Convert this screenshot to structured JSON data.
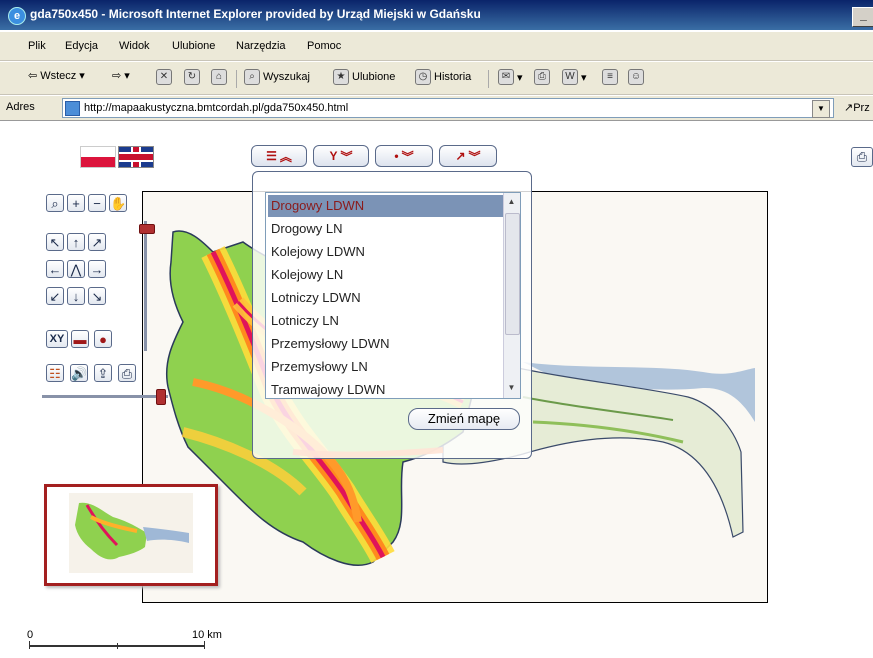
{
  "window": {
    "title": "gda750x450 - Microsoft Internet Explorer provided by Urząd Miejski w Gdańsku",
    "minimize_label": "_"
  },
  "menu": [
    "Plik",
    "Edycja",
    "Widok",
    "Ulubione",
    "Narzędzia",
    "Pomoc"
  ],
  "toolbar": {
    "back": "Wstecz",
    "search": "Wyszukaj",
    "favorites": "Ulubione",
    "history": "Historia"
  },
  "address": {
    "label": "Adres",
    "url": "http://mapaakustyczna.bmtcordah.pl/gda750x450.html",
    "go": "Prz"
  },
  "map_layers": {
    "items": [
      "Drogowy LDWN",
      "Drogowy LN",
      "Kolejowy LDWN",
      "Kolejowy LN",
      "Lotniczy LDWN",
      "Lotniczy LN",
      "Przemysłowy LDWN",
      "Przemysłowy LN",
      "Tramwajowy LDWN"
    ],
    "selected_index": 0,
    "change_button": "Zmień mapę"
  },
  "controls": {
    "xy_label": "XY"
  },
  "scalebar": {
    "start": "0",
    "end": "10 km"
  },
  "colors": {
    "selection": "#7b93b6",
    "accent": "#b01010",
    "overview_border": "#a31f1f"
  }
}
